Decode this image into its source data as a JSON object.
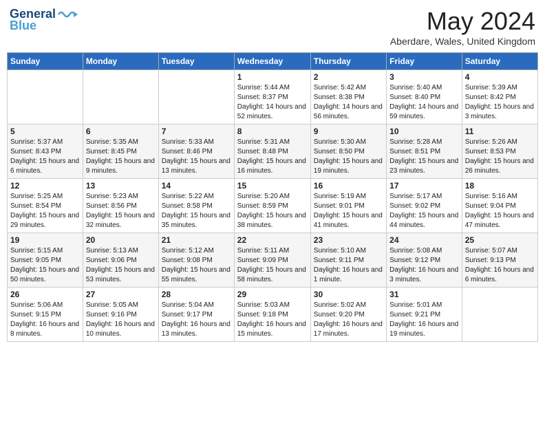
{
  "header": {
    "logo_general": "General",
    "logo_blue": "Blue",
    "month": "May 2024",
    "location": "Aberdare, Wales, United Kingdom"
  },
  "weekdays": [
    "Sunday",
    "Monday",
    "Tuesday",
    "Wednesday",
    "Thursday",
    "Friday",
    "Saturday"
  ],
  "weeks": [
    [
      {
        "day": "",
        "info": ""
      },
      {
        "day": "",
        "info": ""
      },
      {
        "day": "",
        "info": ""
      },
      {
        "day": "1",
        "info": "Sunrise: 5:44 AM\nSunset: 8:37 PM\nDaylight: 14 hours and 52 minutes."
      },
      {
        "day": "2",
        "info": "Sunrise: 5:42 AM\nSunset: 8:38 PM\nDaylight: 14 hours and 56 minutes."
      },
      {
        "day": "3",
        "info": "Sunrise: 5:40 AM\nSunset: 8:40 PM\nDaylight: 14 hours and 59 minutes."
      },
      {
        "day": "4",
        "info": "Sunrise: 5:39 AM\nSunset: 8:42 PM\nDaylight: 15 hours and 3 minutes."
      }
    ],
    [
      {
        "day": "5",
        "info": "Sunrise: 5:37 AM\nSunset: 8:43 PM\nDaylight: 15 hours and 6 minutes."
      },
      {
        "day": "6",
        "info": "Sunrise: 5:35 AM\nSunset: 8:45 PM\nDaylight: 15 hours and 9 minutes."
      },
      {
        "day": "7",
        "info": "Sunrise: 5:33 AM\nSunset: 8:46 PM\nDaylight: 15 hours and 13 minutes."
      },
      {
        "day": "8",
        "info": "Sunrise: 5:31 AM\nSunset: 8:48 PM\nDaylight: 15 hours and 16 minutes."
      },
      {
        "day": "9",
        "info": "Sunrise: 5:30 AM\nSunset: 8:50 PM\nDaylight: 15 hours and 19 minutes."
      },
      {
        "day": "10",
        "info": "Sunrise: 5:28 AM\nSunset: 8:51 PM\nDaylight: 15 hours and 23 minutes."
      },
      {
        "day": "11",
        "info": "Sunrise: 5:26 AM\nSunset: 8:53 PM\nDaylight: 15 hours and 26 minutes."
      }
    ],
    [
      {
        "day": "12",
        "info": "Sunrise: 5:25 AM\nSunset: 8:54 PM\nDaylight: 15 hours and 29 minutes."
      },
      {
        "day": "13",
        "info": "Sunrise: 5:23 AM\nSunset: 8:56 PM\nDaylight: 15 hours and 32 minutes."
      },
      {
        "day": "14",
        "info": "Sunrise: 5:22 AM\nSunset: 8:58 PM\nDaylight: 15 hours and 35 minutes."
      },
      {
        "day": "15",
        "info": "Sunrise: 5:20 AM\nSunset: 8:59 PM\nDaylight: 15 hours and 38 minutes."
      },
      {
        "day": "16",
        "info": "Sunrise: 5:19 AM\nSunset: 9:01 PM\nDaylight: 15 hours and 41 minutes."
      },
      {
        "day": "17",
        "info": "Sunrise: 5:17 AM\nSunset: 9:02 PM\nDaylight: 15 hours and 44 minutes."
      },
      {
        "day": "18",
        "info": "Sunrise: 5:16 AM\nSunset: 9:04 PM\nDaylight: 15 hours and 47 minutes."
      }
    ],
    [
      {
        "day": "19",
        "info": "Sunrise: 5:15 AM\nSunset: 9:05 PM\nDaylight: 15 hours and 50 minutes."
      },
      {
        "day": "20",
        "info": "Sunrise: 5:13 AM\nSunset: 9:06 PM\nDaylight: 15 hours and 53 minutes."
      },
      {
        "day": "21",
        "info": "Sunrise: 5:12 AM\nSunset: 9:08 PM\nDaylight: 15 hours and 55 minutes."
      },
      {
        "day": "22",
        "info": "Sunrise: 5:11 AM\nSunset: 9:09 PM\nDaylight: 15 hours and 58 minutes."
      },
      {
        "day": "23",
        "info": "Sunrise: 5:10 AM\nSunset: 9:11 PM\nDaylight: 16 hours and 1 minute."
      },
      {
        "day": "24",
        "info": "Sunrise: 5:08 AM\nSunset: 9:12 PM\nDaylight: 16 hours and 3 minutes."
      },
      {
        "day": "25",
        "info": "Sunrise: 5:07 AM\nSunset: 9:13 PM\nDaylight: 16 hours and 6 minutes."
      }
    ],
    [
      {
        "day": "26",
        "info": "Sunrise: 5:06 AM\nSunset: 9:15 PM\nDaylight: 16 hours and 8 minutes."
      },
      {
        "day": "27",
        "info": "Sunrise: 5:05 AM\nSunset: 9:16 PM\nDaylight: 16 hours and 10 minutes."
      },
      {
        "day": "28",
        "info": "Sunrise: 5:04 AM\nSunset: 9:17 PM\nDaylight: 16 hours and 13 minutes."
      },
      {
        "day": "29",
        "info": "Sunrise: 5:03 AM\nSunset: 9:18 PM\nDaylight: 16 hours and 15 minutes."
      },
      {
        "day": "30",
        "info": "Sunrise: 5:02 AM\nSunset: 9:20 PM\nDaylight: 16 hours and 17 minutes."
      },
      {
        "day": "31",
        "info": "Sunrise: 5:01 AM\nSunset: 9:21 PM\nDaylight: 16 hours and 19 minutes."
      },
      {
        "day": "",
        "info": ""
      }
    ]
  ]
}
